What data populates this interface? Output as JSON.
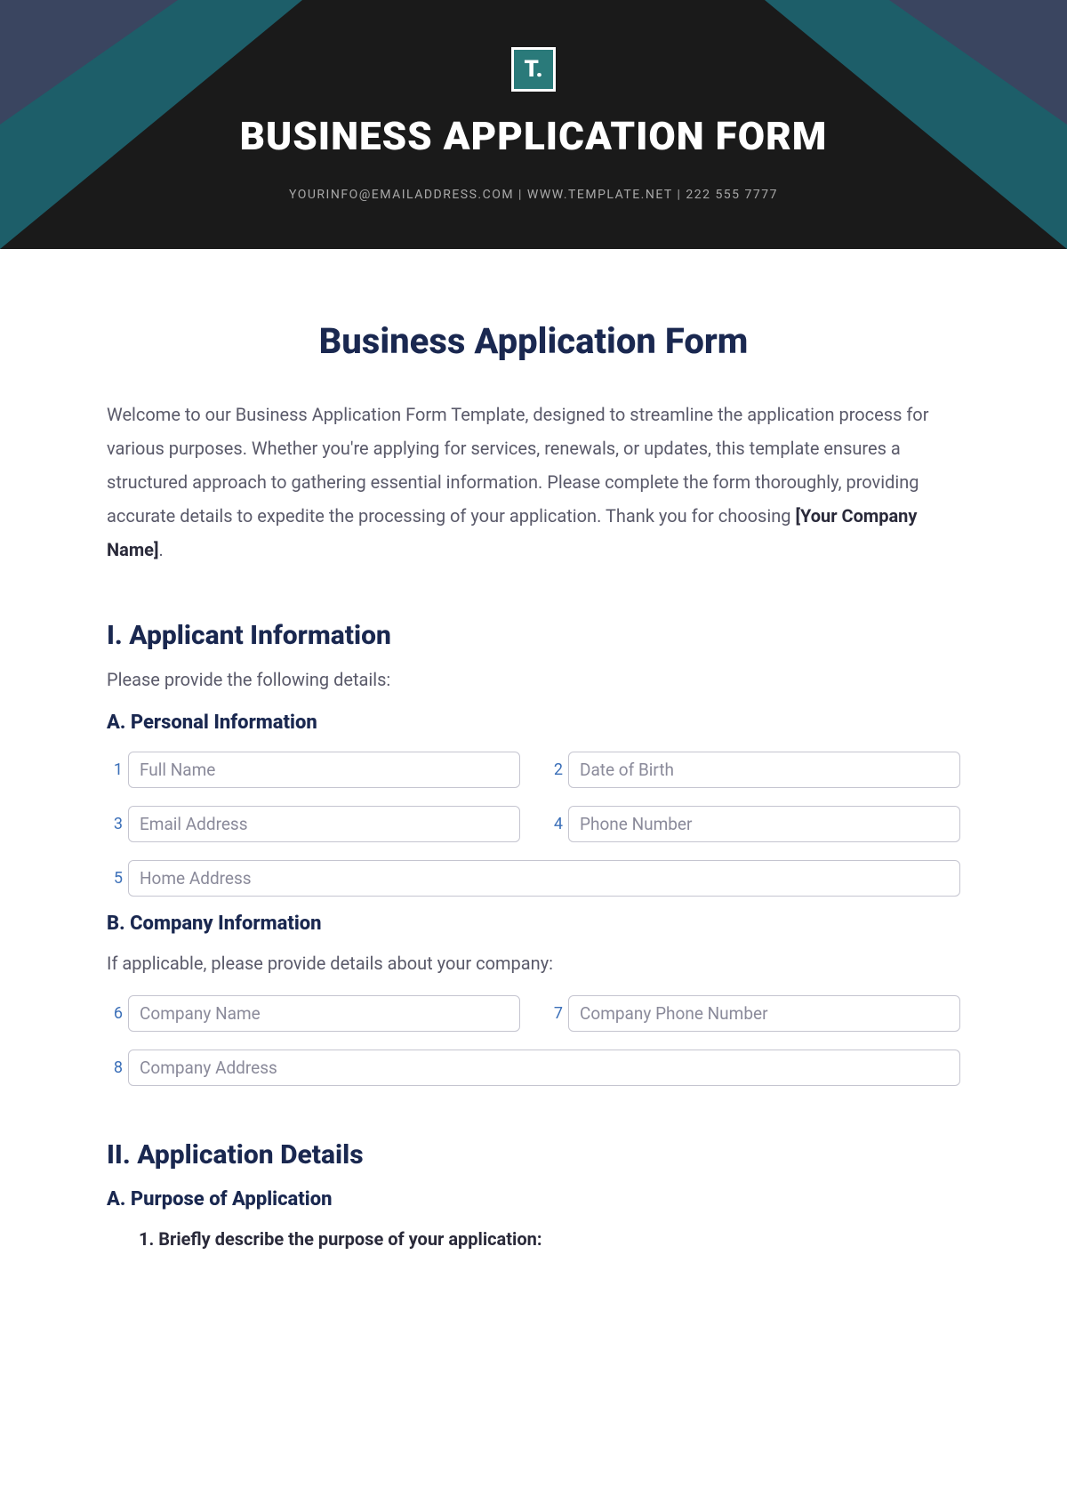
{
  "header": {
    "logo_text": "T.",
    "banner_title": "BUSINESS APPLICATION FORM",
    "contact_line": "YOURINFO@EMAILADDRESS.COM | WWW.TEMPLATE.NET | 222 555 7777"
  },
  "doc": {
    "title": "Business Application Form",
    "intro_prefix": "Welcome to our Business Application Form Template, designed to streamline the application process for various purposes. Whether you're applying for services, renewals, or updates, this template ensures a structured approach to gathering essential information. Please complete the form thoroughly, providing accurate details to expedite the processing of your application. Thank you for choosing ",
    "intro_bold": "[Your Company Name]",
    "intro_suffix": "."
  },
  "section1": {
    "heading": "I. Applicant Information",
    "subtext": "Please provide the following details:",
    "sub_a": {
      "heading": "A. Personal Information",
      "fields": {
        "f1_num": "1",
        "f1_ph": "Full Name",
        "f2_num": "2",
        "f2_ph": "Date of Birth",
        "f3_num": "3",
        "f3_ph": "Email Address",
        "f4_num": "4",
        "f4_ph": "Phone Number",
        "f5_num": "5",
        "f5_ph": "Home Address"
      }
    },
    "sub_b": {
      "heading": "B. Company Information",
      "subtext": "If applicable, please provide details about your company:",
      "fields": {
        "f6_num": "6",
        "f6_ph": "Company Name",
        "f7_num": "7",
        "f7_ph": "Company Phone Number",
        "f8_num": "8",
        "f8_ph": "Company Address"
      }
    }
  },
  "section2": {
    "heading": "II. Application Details",
    "sub_a": {
      "heading": "A. Purpose of Application",
      "item1": "1. Briefly describe the purpose of your application:"
    }
  }
}
